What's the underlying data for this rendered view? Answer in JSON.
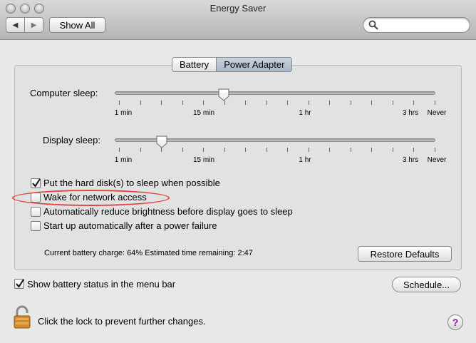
{
  "window": {
    "title": "Energy Saver",
    "nav_back": "◀",
    "nav_forward": "▶",
    "show_all": "Show All",
    "search_placeholder": ""
  },
  "tabs": [
    {
      "label": "Battery",
      "selected": false
    },
    {
      "label": "Power Adapter",
      "selected": true
    }
  ],
  "computer_sleep": {
    "label": "Computer sleep:",
    "ticks": [
      "1 min",
      "15 min",
      "1 hr",
      "3 hrs",
      "Never"
    ],
    "value": "15 min"
  },
  "display_sleep": {
    "label": "Display sleep:",
    "ticks": [
      "1 min",
      "15 min",
      "1 hr",
      "3 hrs",
      "Never"
    ],
    "value": "5 min"
  },
  "options": [
    {
      "label": "Put the hard disk(s) to sleep when possible",
      "checked": true
    },
    {
      "label": "Wake for network access",
      "checked": false
    },
    {
      "label": "Automatically reduce brightness before display goes to sleep",
      "checked": false
    },
    {
      "label": "Start up automatically after a power failure",
      "checked": false
    }
  ],
  "status": {
    "battery_text": "Current battery charge: 64%  Estimated time remaining: 2:47"
  },
  "buttons": {
    "restore_defaults": "Restore Defaults",
    "schedule": "Schedule..."
  },
  "menu_bar_option": {
    "label": "Show battery status in the menu bar",
    "checked": true
  },
  "lock": {
    "text": "Click the lock to prevent further changes."
  },
  "help": {
    "label": "?"
  },
  "colors": {
    "annotation": "#e0463c",
    "help_accent": "#7a1fa0"
  }
}
